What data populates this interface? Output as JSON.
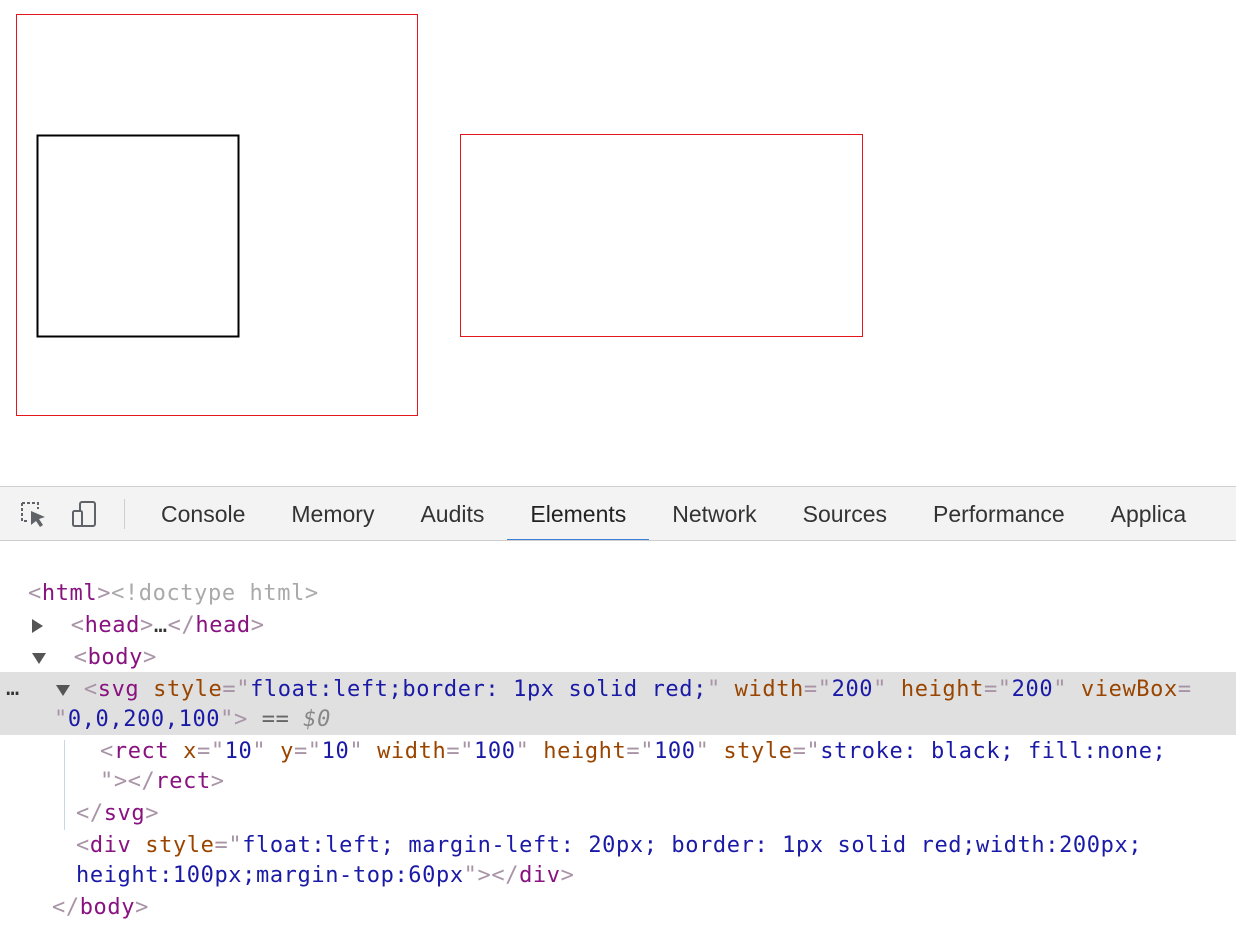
{
  "devtools": {
    "toolbar": {
      "inspect_icon": "inspect-cursor-icon",
      "device_icon": "device-toggle-icon",
      "tabs": [
        {
          "label": "Console",
          "active": false
        },
        {
          "label": "Memory",
          "active": false
        },
        {
          "label": "Audits",
          "active": false
        },
        {
          "label": "Elements",
          "active": true
        },
        {
          "label": "Network",
          "active": false
        },
        {
          "label": "Sources",
          "active": false
        },
        {
          "label": "Performance",
          "active": false
        },
        {
          "label": "Applica",
          "active": false
        }
      ]
    },
    "tree": {
      "doctype": "<!doctype html>",
      "html_open": "html",
      "head_tag": "head",
      "head_ellipsis": "…",
      "body_tag": "body",
      "svg": {
        "tag": "svg",
        "attrs": [
          {
            "name": "style",
            "value": "float:left;border: 1px solid red;"
          },
          {
            "name": "width",
            "value": "200"
          },
          {
            "name": "height",
            "value": "200"
          },
          {
            "name": "viewBox",
            "value": "0,0,200,100"
          }
        ],
        "selected_marker": "== $0",
        "dollar": "$0"
      },
      "rect": {
        "tag": "rect",
        "attrs": [
          {
            "name": "x",
            "value": "10"
          },
          {
            "name": "y",
            "value": "10"
          },
          {
            "name": "width",
            "value": "100"
          },
          {
            "name": "height",
            "value": "100"
          },
          {
            "name": "style",
            "value": "stroke: black; fill:none;"
          }
        ]
      },
      "div": {
        "tag": "div",
        "style_value_1": "float:left; margin-left: 20px; border: 1px solid red;width:200px;",
        "style_value_2": "height:100px;margin-top:60px"
      },
      "dots": "…"
    }
  },
  "colors": {
    "red_border": "#e3161b",
    "active_tab_underline": "#3b7fd4",
    "tag": "#881280",
    "attr_name": "#994500",
    "attr_value": "#1a1aa6"
  }
}
